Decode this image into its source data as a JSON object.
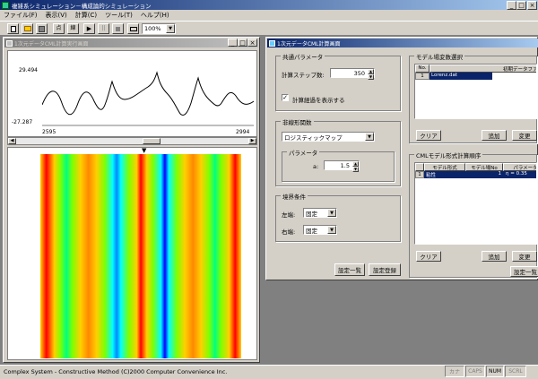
{
  "app": {
    "title": "複雑系シミュレーション－構成論的シミュレーション"
  },
  "menu": [
    "ファイル(F)",
    "表示(V)",
    "計算(C)",
    "ツール(T)",
    "ヘルプ(H)"
  ],
  "toolbar": {
    "zoom": "100%"
  },
  "left_window": {
    "title": "1次元データCML計算実行画面",
    "plot": {
      "y_max": "29.494",
      "y_min": "-27.287",
      "x_min": "2595",
      "x_max": "2994"
    }
  },
  "right_window": {
    "title": "1次元データCML計算画面",
    "common_params": {
      "group_label": "共通パラメータ",
      "step_label": "計算ステップ数:",
      "step_value": "350",
      "show_progress_label": "計算経過を表示する",
      "show_progress_checked": true
    },
    "nonlinear": {
      "group_label": "非線形関数",
      "function": "ロジスティックマップ",
      "param_group_label": "パラメータ",
      "a_label": "a:",
      "a_value": "1.5"
    },
    "boundary": {
      "group_label": "境界条件",
      "left_label": "左端:",
      "left_value": "固定",
      "right_label": "右端:",
      "right_value": "固定"
    },
    "buttons": {
      "list": "設定一覧",
      "register": "設定登録"
    },
    "model_init": {
      "group_label": "モデル場変数選択",
      "headers": [
        "No.",
        "初期データファイル名"
      ],
      "rows": [
        [
          "1",
          "Lorenz.dat"
        ]
      ],
      "clear": "クリア",
      "add": "追加",
      "change": "変更"
    },
    "cml_order": {
      "group_label": "CMLモデル形式計算順序",
      "headers": [
        "",
        "モデル形式",
        "モデル場No",
        "パラメータ"
      ],
      "rows": [
        [
          "1",
          "粘性",
          "1",
          "η = 0.35"
        ]
      ],
      "clear": "クリア",
      "add": "追加",
      "change": "変更",
      "settings": "設定一覧"
    }
  },
  "statusbar": {
    "text": "Complex System - Constructive Method  (C)2000  Computer Convenience Inc.",
    "indicators": [
      "カナ",
      "CAPS",
      "NUM",
      "SCRL"
    ]
  },
  "colors": {
    "title_active": "#0a246a",
    "title_inactive": "#808080",
    "face": "#d4d0c8",
    "select": "#0a246a"
  },
  "icons": [
    "app-icon",
    "new-icon",
    "open-icon",
    "save-icon",
    "run-icon",
    "pause-icon",
    "stop-icon",
    "print-icon"
  ]
}
